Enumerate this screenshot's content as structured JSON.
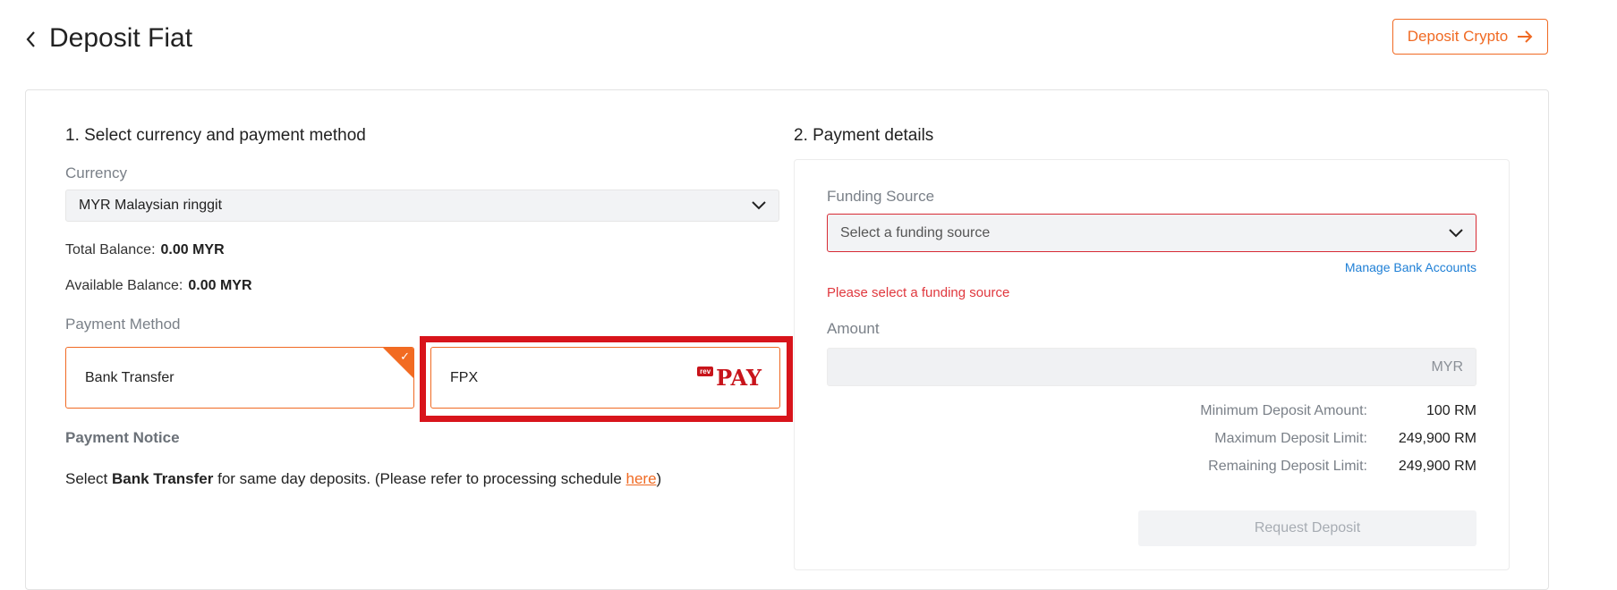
{
  "header": {
    "title": "Deposit Fiat",
    "deposit_crypto_label": "Deposit Crypto"
  },
  "left": {
    "section_title": "1. Select currency and payment method",
    "currency_label": "Currency",
    "currency_value": "MYR Malaysian ringgit",
    "total_balance_label": "Total Balance:",
    "total_balance_value": "0.00 MYR",
    "available_balance_label": "Available Balance:",
    "available_balance_value": "0.00 MYR",
    "payment_method_label": "Payment Method",
    "methods": [
      {
        "label": "Bank Transfer",
        "selected": true
      },
      {
        "label": "FPX",
        "selected": false,
        "logo_small": "rev",
        "logo_big": "PAY"
      }
    ],
    "notice_title": "Payment Notice",
    "notice_prefix": "Select ",
    "notice_bold": "Bank Transfer",
    "notice_middle": " for same day deposits. (Please refer to processing schedule ",
    "notice_link": "here",
    "notice_suffix": ")"
  },
  "right": {
    "section_title": "2. Payment details",
    "funding_label": "Funding Source",
    "funding_placeholder": "Select a funding source",
    "manage_link": "Manage Bank Accounts",
    "error": "Please select a funding source",
    "amount_label": "Amount",
    "amount_currency": "MYR",
    "limits": [
      {
        "label": "Minimum Deposit Amount:",
        "value": "100 RM"
      },
      {
        "label": "Maximum Deposit Limit:",
        "value": "249,900 RM"
      },
      {
        "label": "Remaining Deposit Limit:",
        "value": "249,900 RM"
      }
    ],
    "request_button": "Request Deposit"
  },
  "colors": {
    "accent": "#f06a23",
    "error": "#e0383e",
    "link": "#1e7fd6",
    "highlight": "#d8141b"
  }
}
